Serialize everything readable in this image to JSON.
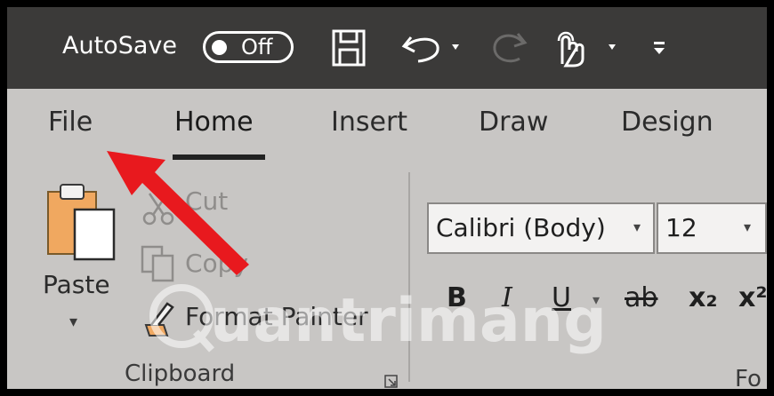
{
  "titlebar": {
    "autosave_label": "AutoSave",
    "autosave_state": "Off"
  },
  "tabs": [
    {
      "label": "File"
    },
    {
      "label": "Home"
    },
    {
      "label": "Insert"
    },
    {
      "label": "Draw"
    },
    {
      "label": "Design"
    }
  ],
  "clipboard": {
    "paste_label": "Paste",
    "cut_label": "Cut",
    "copy_label": "Copy",
    "format_painter_label": "Format Painter",
    "group_label": "Clipboard"
  },
  "font": {
    "font_name": "Calibri (Body)",
    "font_size": "12",
    "bold": "B",
    "italic": "I",
    "underline": "U",
    "strikethrough": "ab",
    "subscript": "x₂",
    "superscript": "x²",
    "group_label": "Fo"
  },
  "watermark": {
    "text": "uantrimang"
  },
  "icons": {
    "save": "save-icon",
    "undo": "undo-icon",
    "redo": "redo-icon",
    "touch": "touch-mode-icon",
    "customize": "customize-toolbar-icon",
    "paste": "clipboard-paste-icon",
    "cut": "scissors-icon",
    "copy": "copy-icon",
    "format_painter": "paintbrush-icon",
    "dialog_launcher": "dialog-launcher-icon",
    "annotation_arrow": "red-arrow-pointer"
  },
  "colors": {
    "titlebar": "#3b3a39",
    "ribbon": "#c8c6c4",
    "annotation_arrow": "#e8191e"
  }
}
